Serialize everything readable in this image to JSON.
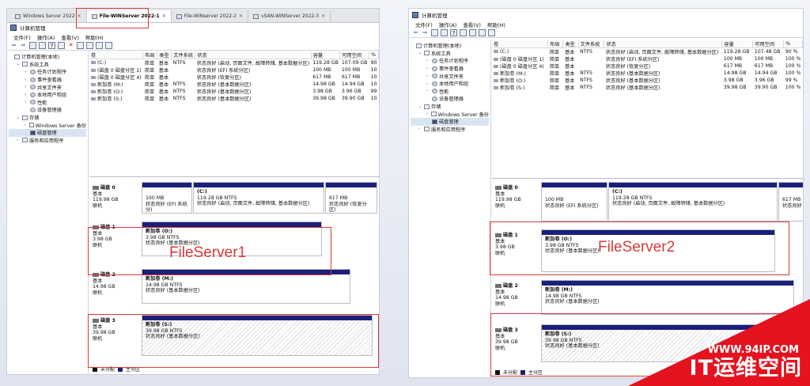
{
  "left": {
    "tabs": [
      {
        "label": "Windows Server 2022",
        "active": false
      },
      {
        "label": "File-WINServer 2022-1",
        "active": true
      },
      {
        "label": "File-WINserver 2022-2",
        "active": false
      },
      {
        "label": "vSAN-WINServer 2022-3",
        "active": false
      }
    ],
    "title": "计算机管理",
    "menu": [
      "文件(F)",
      "操作(A)",
      "查看(V)",
      "帮助(H)"
    ],
    "tree": [
      {
        "label": "计算机管理(本地)",
        "level": 0,
        "caret": ""
      },
      {
        "label": "系统工具",
        "level": 1,
        "caret": "v"
      },
      {
        "label": "任务计划程序",
        "level": 2,
        "caret": ">"
      },
      {
        "label": "事件查看器",
        "level": 2,
        "caret": ">"
      },
      {
        "label": "共享文件夹",
        "level": 2,
        "caret": ">"
      },
      {
        "label": "本地用户和组",
        "level": 2,
        "caret": ">"
      },
      {
        "label": "性能",
        "level": 2,
        "caret": ">"
      },
      {
        "label": "设备管理器",
        "level": 2,
        "caret": ""
      },
      {
        "label": "存储",
        "level": 1,
        "caret": "v"
      },
      {
        "label": "Windows Server 备份",
        "level": 2,
        "caret": ">"
      },
      {
        "label": "磁盘管理",
        "level": 2,
        "caret": "",
        "selected": true
      },
      {
        "label": "服务和应用程序",
        "level": 1,
        "caret": ">"
      }
    ],
    "columns": [
      "卷",
      "布局",
      "类型",
      "文件系统",
      "状态",
      "容量",
      "可用空间",
      "%"
    ],
    "volumes": [
      [
        "(C:)",
        "简单",
        "基本",
        "NTFS",
        "状态良好 (启动, 页面文件, 故障转储, 基本数据分区)",
        "119.28 GB",
        "107.09 GB",
        "90"
      ],
      [
        "(磁盘 0 磁盘分区 1)",
        "简单",
        "基本",
        "",
        "状态良好 (EFI 系统分区)",
        "100 MB",
        "100 MB",
        "10"
      ],
      [
        "(磁盘 0 磁盘分区 4)",
        "简单",
        "基本",
        "",
        "状态良好 (恢复分区)",
        "617 MB",
        "617 MB",
        "10"
      ],
      [
        "新加卷 (M:)",
        "简单",
        "基本",
        "NTFS",
        "状态良好 (基本数据分区)",
        "14.98 GB",
        "14.94 GB",
        "10"
      ],
      [
        "新加卷 (O:)",
        "简单",
        "基本",
        "NTFS",
        "状态良好 (基本数据分区)",
        "3.98 GB",
        "3.96 GB",
        "99"
      ],
      [
        "新加卷 (S:)",
        "简单",
        "基本",
        "NTFS",
        "状态良好 (基本数据分区)",
        "39.98 GB",
        "39.90 GB",
        "10"
      ]
    ],
    "disks": [
      {
        "name": "磁盘 0",
        "type": "基本",
        "size": "119.98 GB",
        "state": "联机",
        "parts": [
          {
            "title": "",
            "size": "100 MB",
            "status": "状态良好 (EFI 系统分)"
          },
          {
            "title": "(C:)",
            "size": "119.28 GB NTFS",
            "status": "状态良好 (启动, 页面文件, 故障转储, 基本数据分区)"
          },
          {
            "title": "",
            "size": "617 MB",
            "status": "状态良好 (恢复分区)"
          }
        ]
      },
      {
        "name": "磁盘 1",
        "type": "基本",
        "size": "3.98 GB",
        "state": "联机",
        "parts": [
          {
            "title": "新加卷 (O:)",
            "size": "3.98 GB NTFS",
            "status": "状态良好 (基本数据分区)"
          }
        ]
      },
      {
        "name": "磁盘 2",
        "type": "基本",
        "size": "14.98 GB",
        "state": "联机",
        "parts": [
          {
            "title": "新加卷 (M:)",
            "size": "14.98 GB NTFS",
            "status": "状态良好 (基本数据分区)"
          }
        ]
      },
      {
        "name": "磁盘 3",
        "type": "基本",
        "size": "39.98 GB",
        "state": "联机",
        "parts": [
          {
            "title": "新加卷 (S:)",
            "size": "39.98 GB NTFS",
            "status": "状态良好 (基本数据分区)"
          }
        ]
      }
    ],
    "legend": [
      "未分配",
      "主分区"
    ],
    "annotation": "FileServer1"
  },
  "right": {
    "title": "计算机管理",
    "menu": [
      "文件(F)",
      "操作(A)",
      "查看(V)",
      "帮助(H)"
    ],
    "tree": [
      {
        "label": "计算机管理(本地)",
        "level": 0,
        "caret": ""
      },
      {
        "label": "系统工具",
        "level": 1,
        "caret": "v"
      },
      {
        "label": "任务计划程序",
        "level": 2,
        "caret": ">"
      },
      {
        "label": "事件查看器",
        "level": 2,
        "caret": ">"
      },
      {
        "label": "共享文件夹",
        "level": 2,
        "caret": ">"
      },
      {
        "label": "本地用户和组",
        "level": 2,
        "caret": ">"
      },
      {
        "label": "性能",
        "level": 2,
        "caret": ">"
      },
      {
        "label": "设备管理器",
        "level": 2,
        "caret": ""
      },
      {
        "label": "存储",
        "level": 1,
        "caret": "v"
      },
      {
        "label": "Windows Server 备份",
        "level": 2,
        "caret": ">"
      },
      {
        "label": "磁盘管理",
        "level": 2,
        "caret": "",
        "selected": true
      },
      {
        "label": "服务和应用程序",
        "level": 1,
        "caret": ">"
      }
    ],
    "columns": [
      "卷",
      "布局",
      "类型",
      "文件系统",
      "状态",
      "容量",
      "可用空间",
      "%"
    ],
    "volumes": [
      [
        "(C:)",
        "简单",
        "基本",
        "NTFS",
        "状态良好 (启动, 页面文件, 故障转储, 基本数据分区)",
        "119.28 GB",
        "107.48 GB",
        "90 %"
      ],
      [
        "(磁盘 0 磁盘分区 1)",
        "简单",
        "基本",
        "",
        "状态良好 (EFI 系统分区)",
        "100 MB",
        "100 MB",
        "100 %"
      ],
      [
        "(磁盘 0 磁盘分区 4)",
        "简单",
        "基本",
        "",
        "状态良好 (恢复分区)",
        "617 MB",
        "617 MB",
        "100 %"
      ],
      [
        "新加卷 (M:)",
        "简单",
        "基本",
        "NTFS",
        "状态良好 (基本数据分区)",
        "14.98 GB",
        "14.94 GB",
        "100 %"
      ],
      [
        "新加卷 (O:)",
        "简单",
        "基本",
        "NTFS",
        "状态良好 (基本数据分区)",
        "3.98 GB",
        "3.96 GB",
        "99 %"
      ],
      [
        "新加卷 (S:)",
        "简单",
        "基本",
        "NTFS",
        "状态良好 (基本数据分区)",
        "39.98 GB",
        "39.90 GB",
        "100 %"
      ]
    ],
    "disks": [
      {
        "name": "磁盘 0",
        "type": "基本",
        "size": "119.98 GB",
        "state": "联机",
        "parts": [
          {
            "title": "",
            "size": "100 MB",
            "status": "状态良好 (EFI 系统分区)"
          },
          {
            "title": "(C:)",
            "size": "119.28 GB NTFS",
            "status": "状态良好 (启动, 页面文件, 故障转储, 基本数据分区)"
          },
          {
            "title": "",
            "size": "617 MB",
            "status": "状态良好"
          }
        ]
      },
      {
        "name": "磁盘 1",
        "type": "基本",
        "size": "3.98 GB",
        "state": "联机",
        "parts": [
          {
            "title": "新加卷 (O:)",
            "size": "3.98 GB NTFS",
            "status": "状态良好 (基本数据分区)"
          }
        ]
      },
      {
        "name": "磁盘 2",
        "type": "基本",
        "size": "14.98 GB",
        "state": "联机",
        "parts": [
          {
            "title": "新加卷 (M:)",
            "size": "14.98 GB NTFS",
            "status": "状态良好 (基本数据分区)"
          }
        ]
      },
      {
        "name": "磁盘 3",
        "type": "基本",
        "size": "39.98 GB",
        "state": "联机",
        "parts": [
          {
            "title": "新加卷 (S:)",
            "size": "39.98 GB NTFS",
            "status": "状态良好 (基本数据分区)"
          }
        ]
      }
    ],
    "legend": [
      "未分配",
      "主分区"
    ],
    "annotation": "FileServer2"
  },
  "watermark": {
    "url": "WWW.94IP.COM",
    "brand": "IT运维空间"
  },
  "colors": {
    "partition_bar": "#1b1f7a",
    "annotation_red": "#d63a3a",
    "watermark_red": "#e5121f"
  }
}
